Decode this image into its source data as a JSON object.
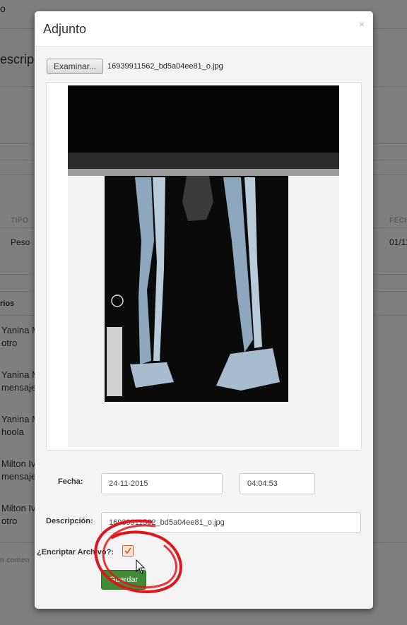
{
  "background": {
    "header_fragment": "o",
    "section_title_fragment": "escripc",
    "table": {
      "col_type_header": "TIPO",
      "col_date_header": "FECH",
      "row_type": "Peso",
      "row_date": "01/11"
    },
    "comments_header_fragment": "rios",
    "comments": [
      {
        "author": "Yanina M",
        "text": "otro"
      },
      {
        "author": "Yanina M",
        "text": "mensaje"
      },
      {
        "author": "Yanina M",
        "text": "hoola"
      },
      {
        "author": "Milton Iv",
        "text": "mensaje"
      },
      {
        "author": "Milton Iv",
        "text": "otro"
      }
    ],
    "footer_fragment": "n comen"
  },
  "modal": {
    "title": "Adjunto",
    "close_symbol": "×",
    "browse_label": "Examinar...",
    "file_name": "16939911562_bd5a04ee81_o.jpg",
    "preview_icon": "xray-image",
    "date_label": "Fecha:",
    "date_value": "24-11-2015",
    "time_value": "04:04:53",
    "description_label": "Descripción:",
    "description_value": "16939911562_bd5a04ee81_o.jpg",
    "encrypt_label": "¿Encriptar Archivo?:",
    "encrypt_checked": true,
    "save_label": "Guardar",
    "colors": {
      "save_button": "#3f8a35",
      "annotation_circle": "#e0151b",
      "overlay": "rgba(0,0,0,0.5)"
    }
  }
}
